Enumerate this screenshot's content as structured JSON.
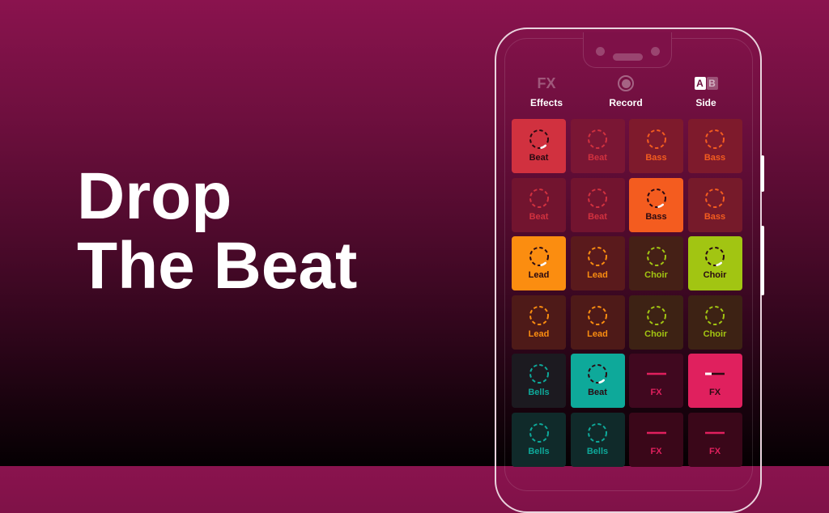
{
  "headline": {
    "line1": "Drop",
    "line2": "The Beat"
  },
  "toolbar": {
    "effects": {
      "icon": "fx-icon",
      "icon_text": "FX",
      "label": "Effects"
    },
    "record": {
      "icon": "record-icon",
      "label": "Record"
    },
    "side": {
      "icon": "ab-side-icon",
      "a": "A",
      "b": "B",
      "label": "Side",
      "active": "A"
    }
  },
  "colors": {
    "background_top": "#8a134e",
    "background_bottom": "#050002",
    "beat": "#d1313f",
    "bass": "#f45c1f",
    "lead": "#fb8d10",
    "choir": "#a2c512",
    "bells": "#0ea99a",
    "fx": "#e0205e"
  },
  "pads": [
    [
      {
        "label": "Beat",
        "group": "beat",
        "active": true,
        "type": "loop"
      },
      {
        "label": "Beat",
        "group": "beat",
        "active": false,
        "type": "loop"
      },
      {
        "label": "Bass",
        "group": "bass",
        "active": false,
        "type": "loop"
      },
      {
        "label": "Bass",
        "group": "bass",
        "active": false,
        "type": "loop"
      }
    ],
    [
      {
        "label": "Beat",
        "group": "beat",
        "active": false,
        "type": "loop"
      },
      {
        "label": "Beat",
        "group": "beat",
        "active": false,
        "type": "loop"
      },
      {
        "label": "Bass",
        "group": "bass",
        "active": true,
        "type": "loop"
      },
      {
        "label": "Bass",
        "group": "bass",
        "active": false,
        "type": "loop"
      }
    ],
    [
      {
        "label": "Lead",
        "group": "lead",
        "active": true,
        "type": "loop"
      },
      {
        "label": "Lead",
        "group": "lead",
        "active": false,
        "type": "loop"
      },
      {
        "label": "Choir",
        "group": "choir",
        "active": false,
        "type": "loop"
      },
      {
        "label": "Choir",
        "group": "choir",
        "active": true,
        "type": "loop"
      }
    ],
    [
      {
        "label": "Lead",
        "group": "lead",
        "active": false,
        "type": "loop"
      },
      {
        "label": "Lead",
        "group": "lead",
        "active": false,
        "type": "loop"
      },
      {
        "label": "Choir",
        "group": "choir",
        "active": false,
        "type": "loop"
      },
      {
        "label": "Choir",
        "group": "choir",
        "active": false,
        "type": "loop"
      }
    ],
    [
      {
        "label": "Bells",
        "group": "bells",
        "active": false,
        "type": "loop"
      },
      {
        "label": "Beat",
        "group": "bells",
        "active": true,
        "type": "loop"
      },
      {
        "label": "FX",
        "group": "fx",
        "active": false,
        "type": "oneshot"
      },
      {
        "label": "FX",
        "group": "fx",
        "active": true,
        "type": "oneshot"
      }
    ],
    [
      {
        "label": "Bells",
        "group": "bells",
        "active": false,
        "type": "loop"
      },
      {
        "label": "Bells",
        "group": "bells",
        "active": false,
        "type": "loop"
      },
      {
        "label": "FX",
        "group": "fx",
        "active": false,
        "type": "oneshot"
      },
      {
        "label": "FX",
        "group": "fx",
        "active": false,
        "type": "oneshot"
      }
    ]
  ]
}
